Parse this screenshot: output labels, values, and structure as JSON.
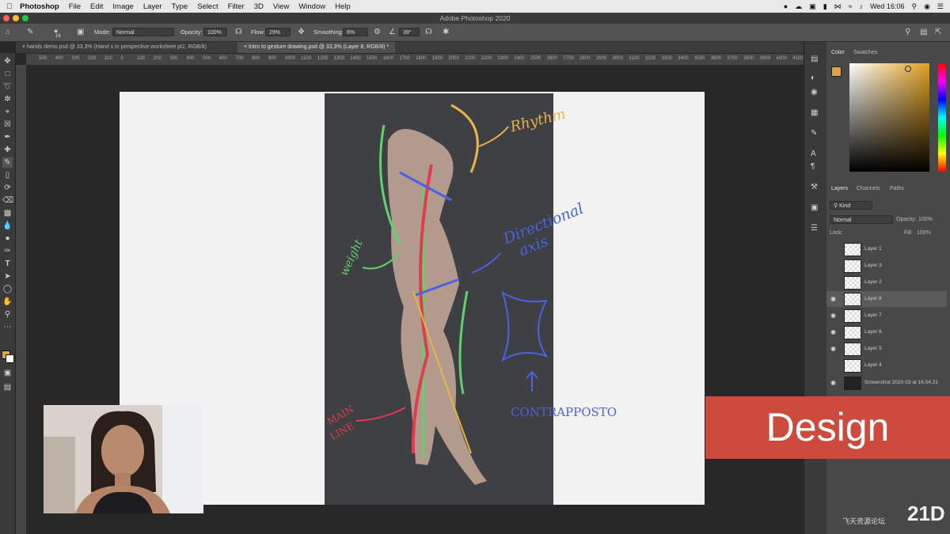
{
  "menubar": {
    "app": "Photoshop",
    "items": [
      "File",
      "Edit",
      "Image",
      "Layer",
      "Type",
      "Select",
      "Filter",
      "3D",
      "View",
      "Window",
      "Help"
    ],
    "clock": "Wed 16:06"
  },
  "window": {
    "title": "Adobe Photoshop 2020"
  },
  "options": {
    "mode_label": "Mode:",
    "mode_value": "Normal",
    "opacity_label": "Opacity:",
    "opacity_value": "100%",
    "flow_label": "Flow:",
    "flow_value": "29%",
    "smoothing_label": "Smoothing:",
    "smoothing_value": "6%",
    "angle_value": "39°",
    "brush_size": "16"
  },
  "tabs": [
    {
      "label": "hands demo.psd @ 33,3% (Hand s in perspective worksheet pt2, RGB/8)"
    },
    {
      "label": "Intro to gesture drawing.psd @ 33,3% (Layer 8, RGB/8) *"
    }
  ],
  "ruler": {
    "ticks": [
      "500",
      "400",
      "300",
      "200",
      "100",
      "0",
      "100",
      "200",
      "300",
      "400",
      "500",
      "600",
      "700",
      "800",
      "900",
      "1000",
      "1100",
      "1200",
      "1300",
      "1400",
      "1500",
      "1600",
      "1700",
      "1800",
      "1900",
      "2000",
      "2100",
      "2200",
      "2300",
      "2400",
      "2500",
      "2600",
      "2700",
      "2800",
      "2900",
      "3000",
      "3100",
      "3200",
      "3300",
      "3400",
      "3500",
      "3600",
      "3700",
      "3800",
      "3900",
      "4000",
      "4100"
    ]
  },
  "annotations": {
    "rhythm": "Rhythm",
    "weight": "weight",
    "directional": "Directional",
    "axis": "axis",
    "main": "MAIN",
    "line": "LINE",
    "contrapposto": "CONTRAPPOSTO"
  },
  "color_panel": {
    "tab1": "Color",
    "tab2": "Swatches"
  },
  "layers_panel": {
    "tabs": [
      "Layers",
      "Channels",
      "Paths"
    ],
    "filter": "Kind",
    "blend": "Normal",
    "opacity_label": "Opacity:",
    "opacity_value": "100%",
    "lock_label": "Lock:",
    "fill_label": "Fill:",
    "fill_value": "100%",
    "layers": [
      {
        "name": "Layer 1",
        "visible": false
      },
      {
        "name": "Layer 3",
        "visible": false
      },
      {
        "name": "Layer 2",
        "visible": false
      },
      {
        "name": "Layer 8",
        "visible": true,
        "selected": true
      },
      {
        "name": "Layer 7",
        "visible": true
      },
      {
        "name": "Layer 6",
        "visible": true
      },
      {
        "name": "Layer 5",
        "visible": true
      },
      {
        "name": "Layer 4",
        "visible": false
      },
      {
        "name": "Screenshot 2020-03 at 16.54.21",
        "visible": true
      }
    ]
  },
  "banner": {
    "text": "Design"
  },
  "watermark": {
    "text": "飞天资源论坛",
    "logo": "21D"
  },
  "colors": {
    "accent_banner": "#cc4b3c",
    "foreground": "#d9a441",
    "background": "#ffffff"
  }
}
